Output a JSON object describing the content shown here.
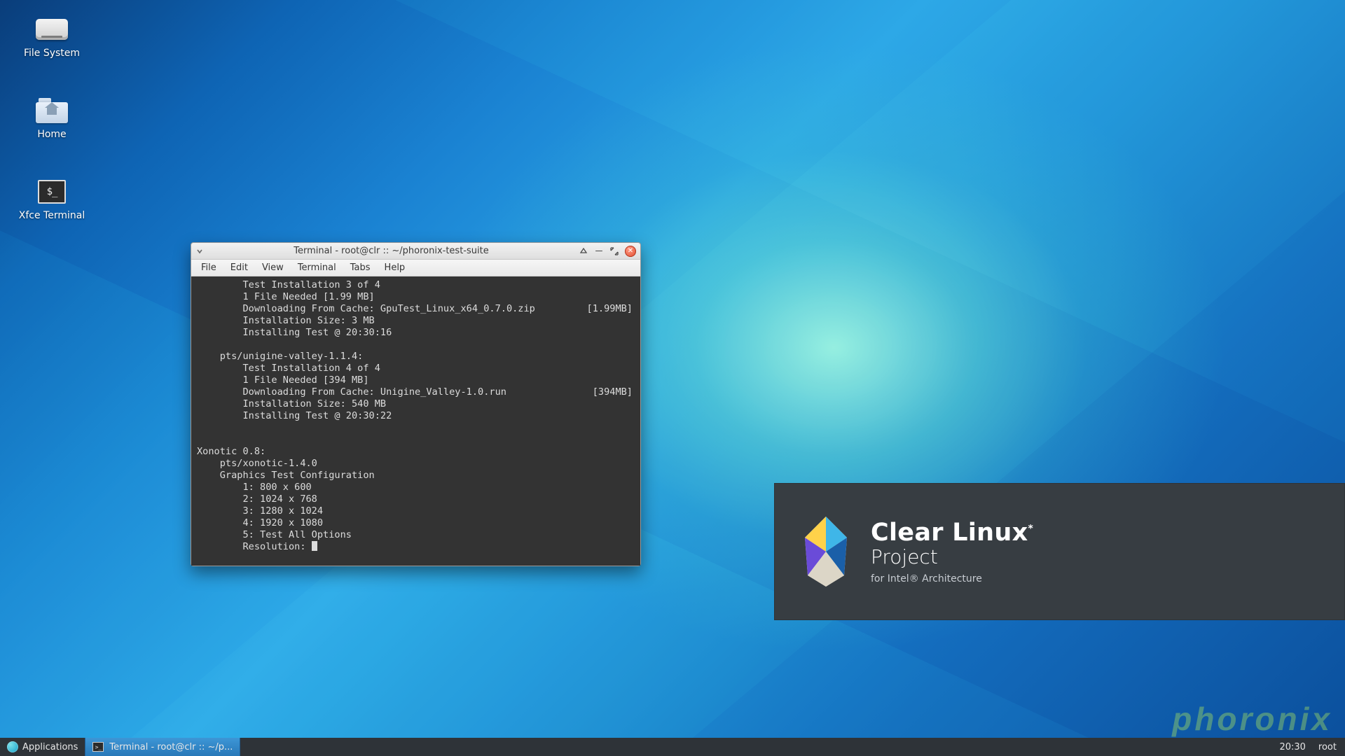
{
  "desktop_icons": {
    "filesystem": "File System",
    "home": "Home",
    "terminal": "Xfce Terminal"
  },
  "window": {
    "title": "Terminal - root@clr :: ~/phoronix-test-suite",
    "menu": {
      "file": "File",
      "edit": "Edit",
      "view": "View",
      "terminal": "Terminal",
      "tabs": "Tabs",
      "help": "Help"
    }
  },
  "terminal": {
    "lines": [
      "        Test Installation 3 of 4",
      "        1 File Needed [1.99 MB]",
      "        Downloading From Cache: GpuTest_Linux_x64_0.7.0.zip         [1.99MB]",
      "        Installation Size: 3 MB",
      "        Installing Test @ 20:30:16",
      "",
      "    pts/unigine-valley-1.1.4:",
      "        Test Installation 4 of 4",
      "        1 File Needed [394 MB]",
      "        Downloading From Cache: Unigine_Valley-1.0.run               [394MB]",
      "        Installation Size: 540 MB",
      "        Installing Test @ 20:30:22",
      "",
      "",
      "Xonotic 0.8:",
      "    pts/xonotic-1.4.0",
      "    Graphics Test Configuration",
      "        1: 800 x 600",
      "        2: 1024 x 768",
      "        3: 1280 x 1024",
      "        4: 1920 x 1080",
      "        5: Test All Options",
      "        Resolution: "
    ]
  },
  "clearlinux": {
    "title_main": "Clear Linux",
    "title_project": "Project",
    "subtitle": "for Intel® Architecture"
  },
  "watermark": "phoronix",
  "taskbar": {
    "applications": "Applications",
    "window_button": "Terminal - root@clr :: ~/p...",
    "clock": "20:30",
    "user": "root"
  }
}
